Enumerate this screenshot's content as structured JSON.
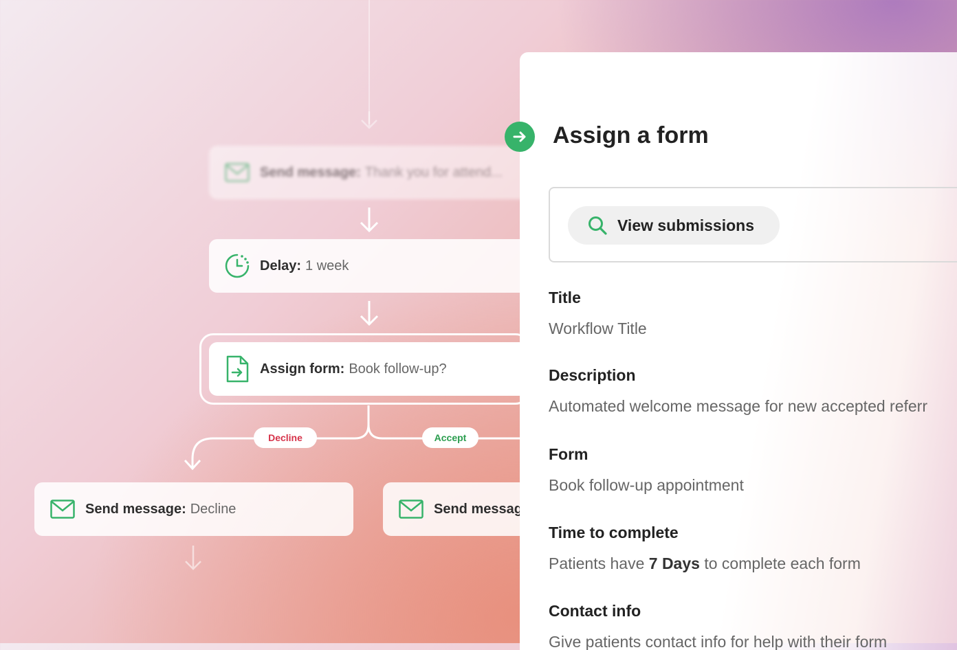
{
  "flow": {
    "nodes": [
      {
        "type": "send-message",
        "label": "Send message:",
        "value": "Thank you for attend..."
      },
      {
        "type": "delay",
        "label": "Delay:",
        "value": "1 week"
      },
      {
        "type": "assign-form",
        "label": "Assign form:",
        "value": "Book follow-up?"
      },
      {
        "type": "send-message",
        "label": "Send message:",
        "value": "Decline"
      },
      {
        "type": "send-message",
        "label": "Send messag",
        "value": ""
      }
    ],
    "branches": {
      "decline": "Decline",
      "accept": "Accept"
    }
  },
  "panel": {
    "title": "Assign a form",
    "view_submissions": "View submissions",
    "fields": [
      {
        "label": "Title",
        "value": "Workflow Title"
      },
      {
        "label": "Description",
        "value": "Automated welcome message for new accepted referr"
      },
      {
        "label": "Form",
        "value": "Book follow-up appointment"
      },
      {
        "label": "Time to complete",
        "value_prefix": "Patients have ",
        "value_bold": "7 Days",
        "value_suffix": " to complete each form"
      },
      {
        "label": "Contact info",
        "value": "Give patients contact info for help with their form"
      }
    ]
  },
  "colors": {
    "accent_green": "#37b36a",
    "decline_red": "#d6334a",
    "accept_green": "#2a9d4e"
  },
  "icons": [
    "envelope-icon",
    "clock-icon",
    "form-assign-icon",
    "search-icon",
    "arrow-right-icon"
  ]
}
